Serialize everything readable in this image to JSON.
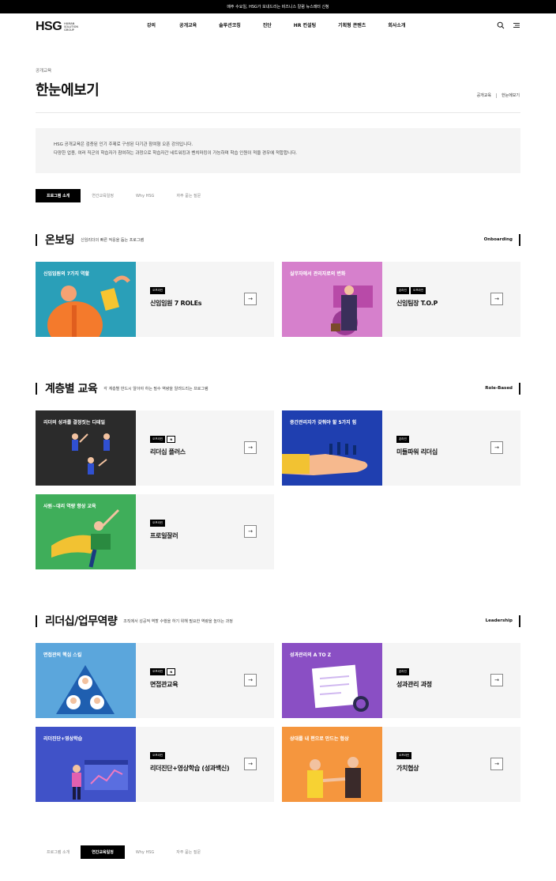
{
  "topbar": {
    "text": "매주 수요일, HSG가 보내드리는 비즈니스 칼럼 뉴스레터 신청"
  },
  "header": {
    "logo": "HSG",
    "logo_sub": "HUMAN SOLUTION GROUP",
    "nav": [
      "강의",
      "공개교육",
      "솔루션코칭",
      "진단",
      "HR 컨설팅",
      "기획형 콘텐츠",
      "회사소개"
    ]
  },
  "page": {
    "crumb_small": "공개교육",
    "title": "한눈에보기",
    "breadcrumb": [
      "공개교육",
      "한눈에보기"
    ],
    "intro_lines": [
      "HSG 공개교육은 검증된 인기 주제로 구성된 다기관 참여형 오픈 강의입니다.",
      "다양한 업종, 여러 직군의 학습자가 참여하는 과정으로 학습자간 네트워킹과 벤치마킹이 가능하며 학습 인원이 적을 경우에 적합합니다."
    ]
  },
  "tabs_top": [
    "프로그램 소개",
    "연간교육일정",
    "Why HSG",
    "자주 묻는 질문"
  ],
  "tabs_bottom": [
    "프로그램 소개",
    "연간교육일정",
    "Why HSG",
    "자주 묻는 질문"
  ],
  "sections": [
    {
      "title": "온보딩",
      "desc": "신임리더의 빠른 적응을 돕는 프로그램",
      "en": "Onboarding",
      "cards": [
        {
          "caption": "신임임원의 7가지 역할",
          "badges": [
            "오프라인"
          ],
          "title": "신임임원 7 ROLEs",
          "color": "#2a9fb8"
        },
        {
          "caption": "실무자에서 관리자로의 변화",
          "badges": [
            "온라인",
            "오프라인"
          ],
          "title": "신임팀장 T.O.P",
          "color": "#d680cc"
        }
      ]
    },
    {
      "title": "계층별 교육",
      "desc": "각 계층별 반드시 알아야 하는 필수 역량을 알려드리는 프로그램",
      "en": "Role-Based",
      "cards": [
        {
          "caption": "리더의 성과를 결정짓는 디테일",
          "badges": [
            "오프라인",
            "N"
          ],
          "title": "리더십 플러스",
          "color": "#2b2b2b"
        },
        {
          "caption": "중간관리자가 갖춰야 할 5가지 힘",
          "badges": [
            "온라인"
          ],
          "title": "미들파워 리더십",
          "color": "#1f3fb0"
        },
        {
          "caption": "사원~대리 역량 향상 교육",
          "badges": [
            "오프라인"
          ],
          "title": "프로일잘러",
          "color": "#3fae5a"
        }
      ]
    },
    {
      "title": "리더십/업무역량",
      "desc": "조직에서 성공적 역할 수행을 하기 위해 필요한 역량을 높이는 과정",
      "en": "Leadership",
      "cards": [
        {
          "caption": "면접관의 핵심 스킬",
          "badges": [
            "오프라인",
            "N"
          ],
          "title": "면접관교육",
          "color": "#5ba6dc"
        },
        {
          "caption": "성과관리의 A TO Z",
          "badges": [
            "온라인"
          ],
          "title": "성과관리 과정",
          "color": "#8a4fc4"
        },
        {
          "caption": "리더진단+영상학습",
          "badges": [
            "오프라인"
          ],
          "title": "리더진단+영상학습 (성과백신)",
          "color": "#4052c8"
        },
        {
          "caption": "상대를 내 편으로 만드는 협상",
          "badges": [
            "오프라인"
          ],
          "title": "가치협상",
          "color": "#f5963e"
        }
      ]
    }
  ]
}
